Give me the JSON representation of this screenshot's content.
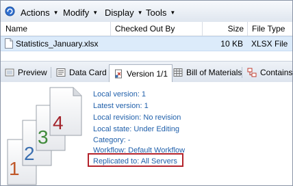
{
  "toolbar": {
    "menus": [
      {
        "label": "Actions"
      },
      {
        "label": "Modify"
      },
      {
        "label": "Display"
      },
      {
        "label": "Tools"
      }
    ],
    "caret": "▼"
  },
  "file_table": {
    "columns": [
      "Name",
      "Checked Out By",
      "Size",
      "File Type"
    ],
    "rows": [
      {
        "name": "Statistics_January.xlsx",
        "checked_out_by": "",
        "size": "10 KB",
        "file_type": "XLSX File"
      }
    ]
  },
  "tabs": [
    {
      "label": "Preview",
      "icon": "preview-icon"
    },
    {
      "label": "Data Card",
      "icon": "data-card-icon"
    },
    {
      "label": "Version 1/1",
      "icon": "version-icon",
      "active": true
    },
    {
      "label": "Bill of Materials",
      "icon": "bill-of-materials-icon"
    },
    {
      "label": "Contains",
      "icon": "contains-icon"
    }
  ],
  "version_panel": {
    "page_numbers": [
      "1",
      "2",
      "3",
      "4"
    ],
    "lines": [
      "Local version: 1",
      "Latest version: 1",
      "Local revision: No revision",
      "Local state: Under Editing",
      "Category: -",
      "Workflow: Default Workflow",
      "Replicated to: All Servers"
    ]
  },
  "colors": {
    "link_text": "#1f5faa",
    "highlight_border": "#b3222a",
    "selected_row": "#dcebfa",
    "page_num_1": "#c0582a",
    "page_num_2": "#3a6fb0",
    "page_num_3": "#3f8a3a",
    "page_num_4": "#a3232b"
  }
}
